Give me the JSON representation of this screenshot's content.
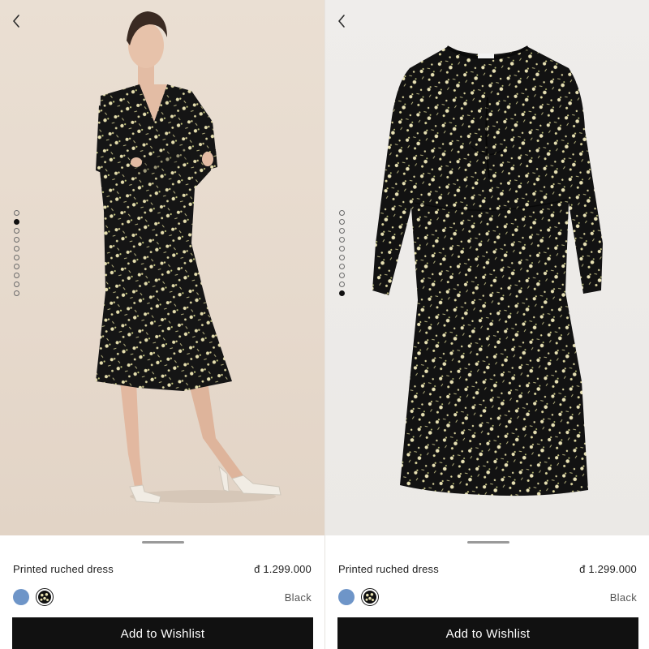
{
  "panels": [
    {
      "image_type": "model-photo",
      "active_slide": 1,
      "slide_count": 10,
      "product": {
        "name": "Printed ruched dress",
        "price": "đ 1.299.000",
        "selected_color": "Black",
        "swatches": [
          {
            "name": "blue-swatch",
            "color": "#6e95c8"
          },
          {
            "name": "black-print-swatch",
            "color": "#111111",
            "selected": true
          }
        ]
      },
      "cta_label": "Add to Wishlist"
    },
    {
      "image_type": "flat-lay-photo",
      "active_slide": 10,
      "slide_count": 10,
      "product": {
        "name": "Printed ruched dress",
        "price": "đ 1.299.000",
        "selected_color": "Black",
        "swatches": [
          {
            "name": "blue-swatch",
            "color": "#6e95c8"
          },
          {
            "name": "black-print-swatch",
            "color": "#111111",
            "selected": true
          }
        ]
      },
      "cta_label": "Add to Wishlist"
    }
  ],
  "icons": {
    "back": "chevron-left-icon"
  },
  "colors": {
    "button_bg": "#111111",
    "button_text": "#ffffff",
    "print_accent": "#e8e1b0"
  }
}
